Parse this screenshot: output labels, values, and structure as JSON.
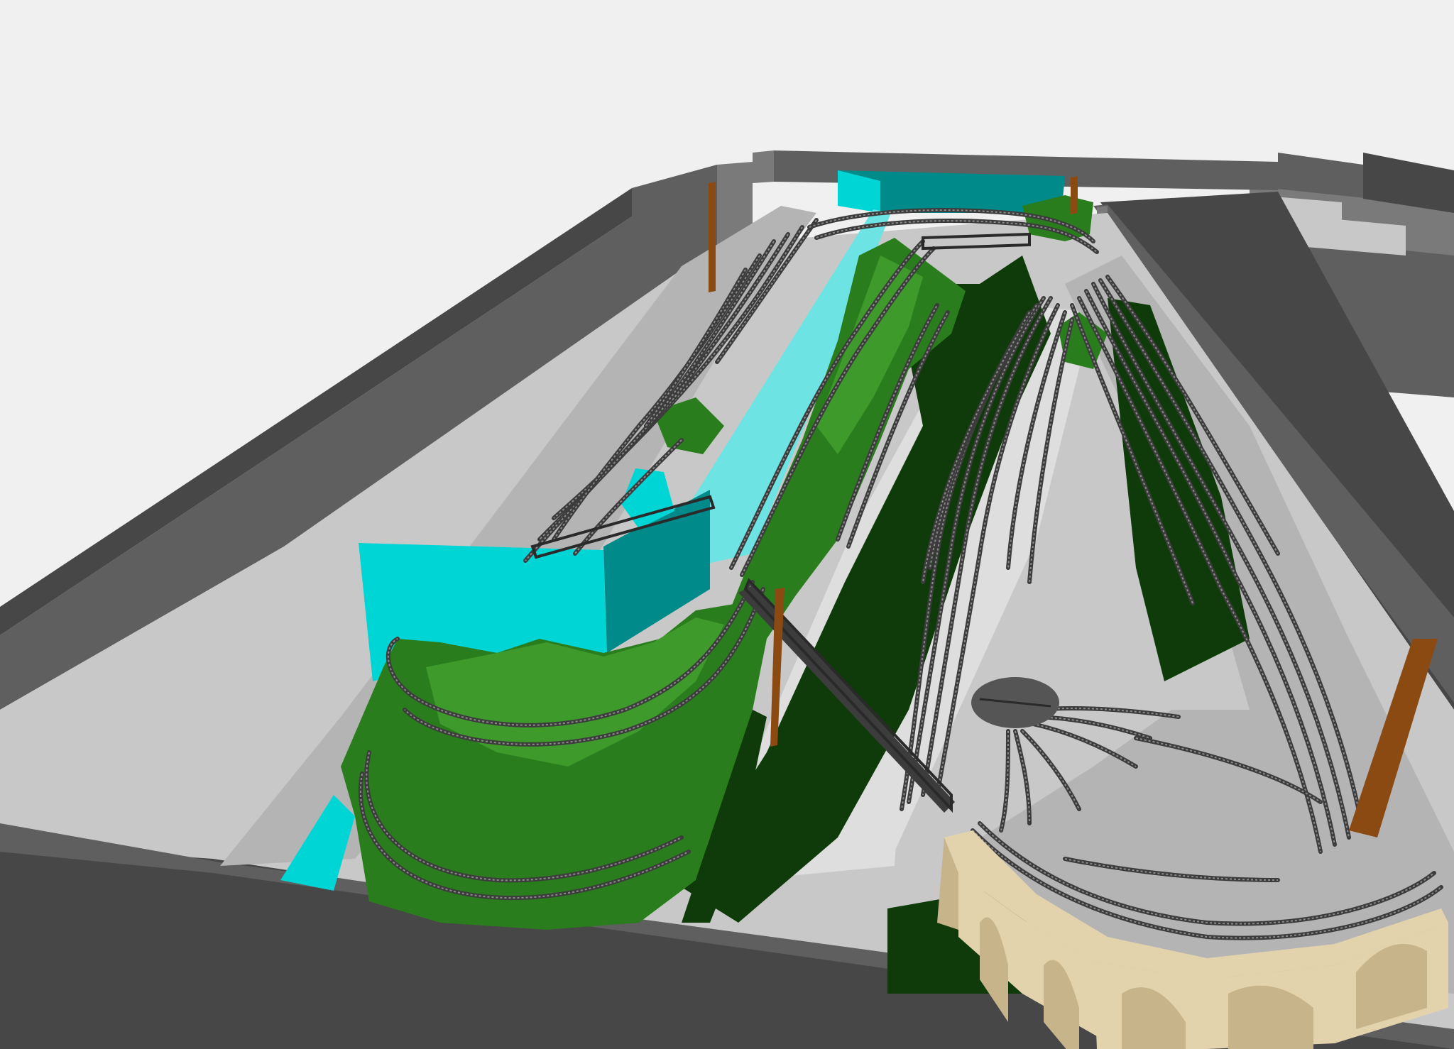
{
  "scene": {
    "background_color": "#f0f0f0",
    "colors": {
      "wall_dark": "#474747",
      "wall_mid": "#5f5f5f",
      "wall_light": "#7a7a7a",
      "floor": "#c8c8c8",
      "floor_light": "#dedede",
      "benchwork": "#b4b4b4",
      "backdrop_cyan": "#00d5d5",
      "backdrop_teal": "#008a8a",
      "backdrop_pale": "#6ee3e3",
      "terrain_green": "#2a7d1c",
      "terrain_light": "#3f9a2c",
      "terrain_dark": "#0f3a0a",
      "track": "#3c3c3c",
      "track_light": "#8a8a8a",
      "viaduct_tan": "#e3d3ad",
      "viaduct_shade": "#c8b48a",
      "post_brown": "#8a4a12",
      "turntable": "#555555"
    }
  }
}
